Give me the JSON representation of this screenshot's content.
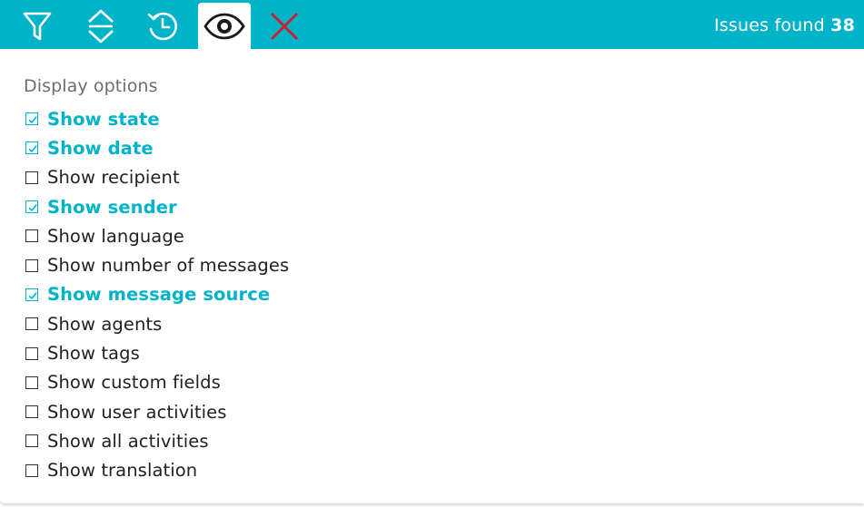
{
  "toolbar": {
    "tools": [
      {
        "icon": "filter-icon",
        "active": false
      },
      {
        "icon": "sort-icon",
        "active": false
      },
      {
        "icon": "history-icon",
        "active": false
      },
      {
        "icon": "eye-icon",
        "active": true
      },
      {
        "icon": "close-icon",
        "active": false
      }
    ],
    "issues_label": "Issues found",
    "issues_count": "38"
  },
  "colors": {
    "accent": "#00b3c9",
    "close": "#c8202a",
    "text": "#222222",
    "muted": "#6e6e6e"
  },
  "display_options": {
    "title": "Display options",
    "items": [
      {
        "label": "Show state",
        "checked": true
      },
      {
        "label": "Show date",
        "checked": true
      },
      {
        "label": "Show recipient",
        "checked": false
      },
      {
        "label": "Show sender",
        "checked": true
      },
      {
        "label": "Show language",
        "checked": false
      },
      {
        "label": "Show number of messages",
        "checked": false
      },
      {
        "label": "Show message source",
        "checked": true
      },
      {
        "label": "Show agents",
        "checked": false
      },
      {
        "label": "Show tags",
        "checked": false
      },
      {
        "label": "Show custom fields",
        "checked": false
      },
      {
        "label": "Show user activities",
        "checked": false
      },
      {
        "label": "Show all activities",
        "checked": false
      },
      {
        "label": "Show translation",
        "checked": false
      }
    ]
  }
}
